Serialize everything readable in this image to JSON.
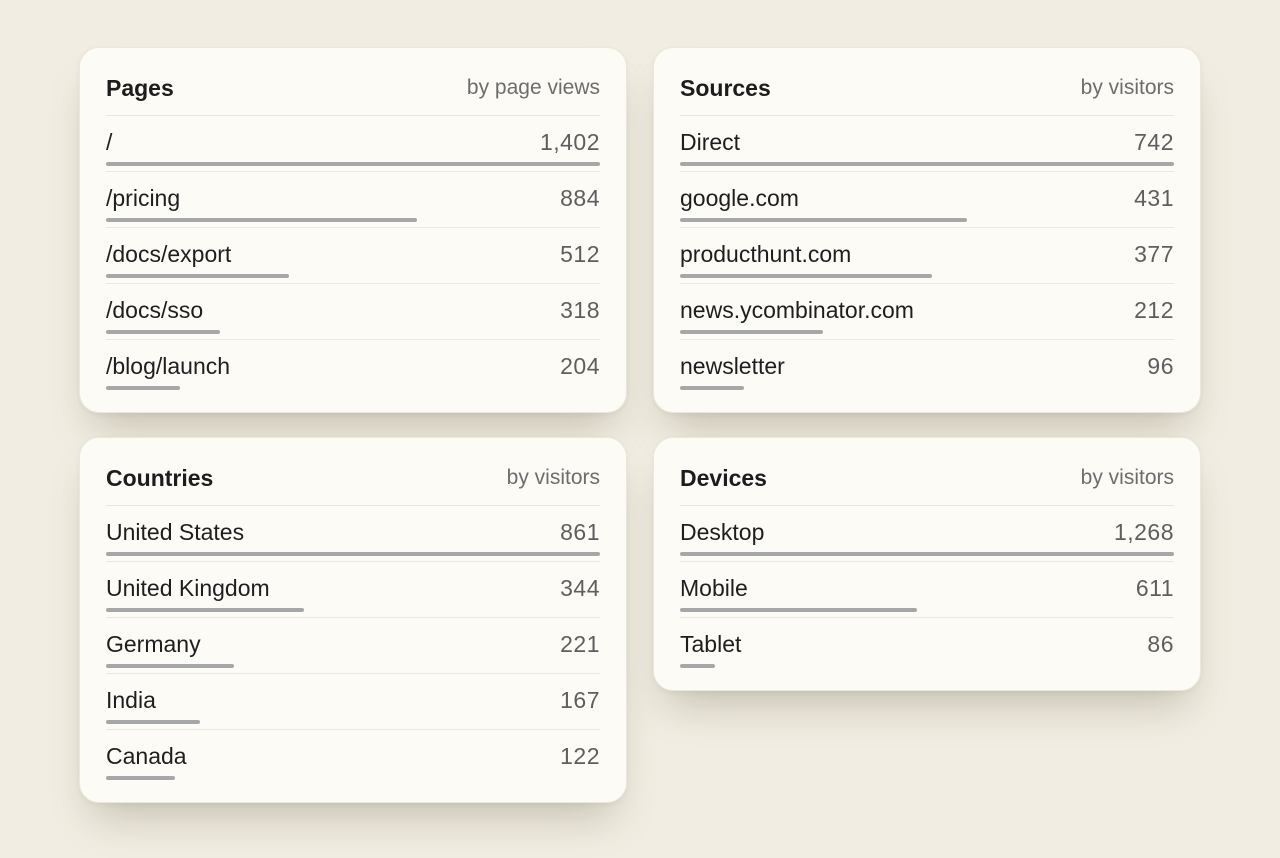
{
  "colors": {
    "background": "#f1ede2",
    "card": "#fcfbf6",
    "bar": "#a5a7a9",
    "value_text": "#5e5e5e"
  },
  "cards": [
    {
      "title": "Pages",
      "subtitle": "by page views",
      "rows": [
        {
          "label": "/",
          "value": "1,402",
          "fraction": 1.0
        },
        {
          "label": "/pricing",
          "value": "884",
          "fraction": 0.63
        },
        {
          "label": "/docs/export",
          "value": "512",
          "fraction": 0.37
        },
        {
          "label": "/docs/sso",
          "value": "318",
          "fraction": 0.23
        },
        {
          "label": "/blog/launch",
          "value": "204",
          "fraction": 0.15
        }
      ]
    },
    {
      "title": "Sources",
      "subtitle": "by visitors",
      "rows": [
        {
          "label": "Direct",
          "value": "742",
          "fraction": 1.0
        },
        {
          "label": "google.com",
          "value": "431",
          "fraction": 0.58
        },
        {
          "label": "producthunt.com",
          "value": "377",
          "fraction": 0.51
        },
        {
          "label": "news.ycombinator.com",
          "value": "212",
          "fraction": 0.29
        },
        {
          "label": "newsletter",
          "value": "96",
          "fraction": 0.13
        }
      ]
    },
    {
      "title": "Countries",
      "subtitle": "by visitors",
      "rows": [
        {
          "label": "United States",
          "value": "861",
          "fraction": 1.0
        },
        {
          "label": "United Kingdom",
          "value": "344",
          "fraction": 0.4
        },
        {
          "label": "Germany",
          "value": "221",
          "fraction": 0.26
        },
        {
          "label": "India",
          "value": "167",
          "fraction": 0.19
        },
        {
          "label": "Canada",
          "value": "122",
          "fraction": 0.14
        }
      ]
    },
    {
      "title": "Devices",
      "subtitle": "by visitors",
      "rows": [
        {
          "label": "Desktop",
          "value": "1,268",
          "fraction": 1.0
        },
        {
          "label": "Mobile",
          "value": "611",
          "fraction": 0.48
        },
        {
          "label": "Tablet",
          "value": "86",
          "fraction": 0.07
        }
      ]
    }
  ]
}
